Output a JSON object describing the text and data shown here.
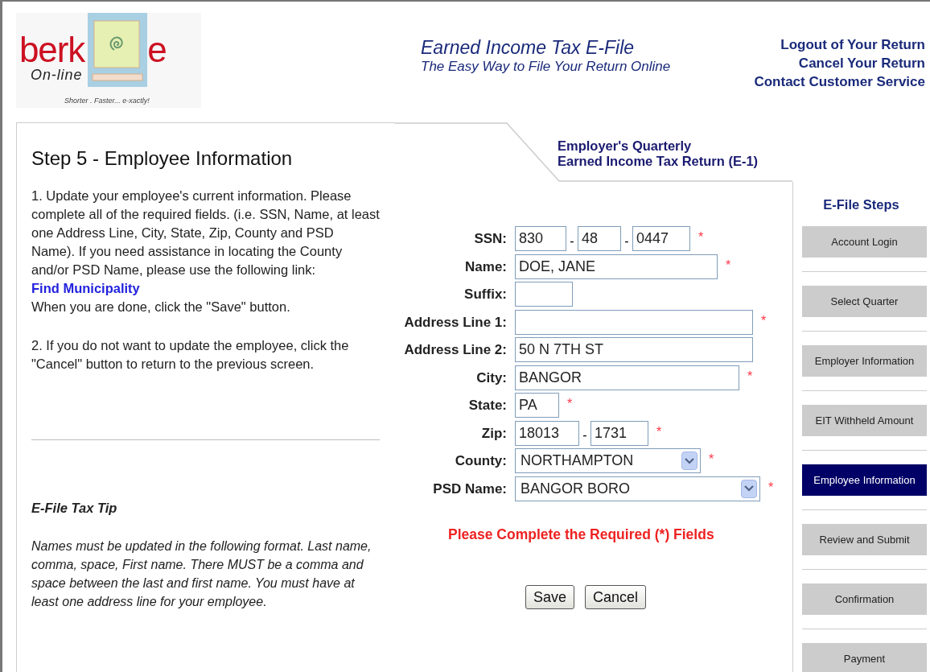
{
  "logo": {
    "wordmark": "berk",
    "wordmark_end": "e",
    "subtitle": "On-line",
    "tagline": "Shorter . Faster... e-xactly!"
  },
  "header": {
    "title": "Earned Income Tax E-File",
    "subtitle": "The Easy Way to File Your Return Online"
  },
  "header_links": [
    "Logout of Your Return",
    "Cancel Your Return",
    "Contact Customer Service"
  ],
  "page_title": "Step 5 - Employee Information",
  "form_tab": {
    "line_1": "Employer's Quarterly",
    "line_2": "Earned Income Tax Return (E-1)"
  },
  "instructions": [
    {
      "text": "1. Update your employee's current information. Please complete all of the required fields. (i.e. SSN, Name, at least one Address Line, City, State, Zip, County and PSD Name). If you need assistance in locating the County and/or PSD Name, please use the following link:",
      "link": "Find Municipality",
      "after": "When you are done, click the \"Save\" button."
    },
    {
      "text": "2. If you do not want to update the employee, click the \"Cancel\" button to return to the previous screen."
    }
  ],
  "tip": {
    "title": "E-File Tax Tip",
    "body": "Names must be updated in the following format. Last name, comma, space, First name. There MUST be a comma and space between the last and first name. You must have at least one address line for your employee."
  },
  "fields": [
    {
      "label": "SSN:",
      "kind": "text",
      "required": true,
      "parts": [
        {
          "value": "830"
        },
        {
          "value": "48"
        },
        {
          "value": "0447"
        }
      ]
    },
    {
      "label": "Name:",
      "kind": "text",
      "required": true,
      "parts": [
        {
          "value": "DOE, JANE"
        }
      ]
    },
    {
      "label": "Suffix:",
      "kind": "text",
      "required": false
    },
    {
      "label": "Address Line 1:",
      "kind": "text",
      "required": true
    },
    {
      "label": "Address Line 2:",
      "kind": "text",
      "required": false,
      "parts": [
        {
          "value": "50 N 7TH ST"
        }
      ]
    },
    {
      "label": "City:",
      "kind": "text",
      "required": true,
      "parts": [
        {
          "value": "BANGOR"
        }
      ]
    },
    {
      "label": "State:",
      "kind": "text",
      "required": true,
      "parts": [
        {
          "value": "PA"
        }
      ]
    },
    {
      "label": "Zip:",
      "kind": "text",
      "required": true,
      "parts": [
        {
          "value": "18013"
        },
        {
          "value": "1731"
        }
      ]
    },
    {
      "label": "County:",
      "kind": "select",
      "required": true,
      "parts": [
        {
          "value": "NORTHAMPTON"
        }
      ]
    },
    {
      "label": "PSD Name:",
      "kind": "select",
      "required": true,
      "parts": [
        {
          "value": "BANGOR BORO"
        }
      ]
    }
  ],
  "part_separator": "-",
  "required_mark": "*",
  "error": "Please Complete the Required (*) Fields",
  "buttons": [
    "Save",
    "Cancel"
  ],
  "steps_title": "E-File Steps",
  "steps": [
    {
      "label": "Account Login",
      "selected": false
    },
    {
      "label": "Select Quarter",
      "selected": false
    },
    {
      "label": "Employer Information",
      "selected": false
    },
    {
      "label": "EIT Withheld Amount",
      "selected": false
    },
    {
      "label": "Employee Information",
      "selected": true
    },
    {
      "label": "Review and Submit",
      "selected": false
    },
    {
      "label": "Confirmation",
      "selected": false
    },
    {
      "label": "Payment",
      "selected": false
    }
  ]
}
